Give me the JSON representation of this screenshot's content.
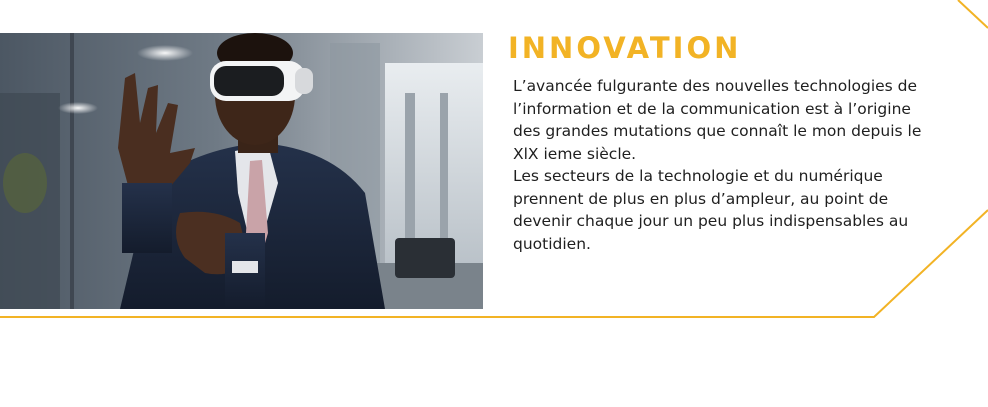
{
  "section": {
    "title": "INNOVATION",
    "paragraphs": [
      "L’avancée fulgurante des nouvelles technologies de l’information et de la communication est à l’origine des grandes mutations que connaît le mon depuis le XlX ieme siècle.",
      "Les secteurs de la technologie et du numérique prennent de plus en plus d’ampleur, au point de devenir chaque jour un peu plus indispensables au quotidien."
    ]
  },
  "colors": {
    "accent": "#f2b325",
    "text": "#1f1f1f",
    "background": "#ffffff"
  }
}
